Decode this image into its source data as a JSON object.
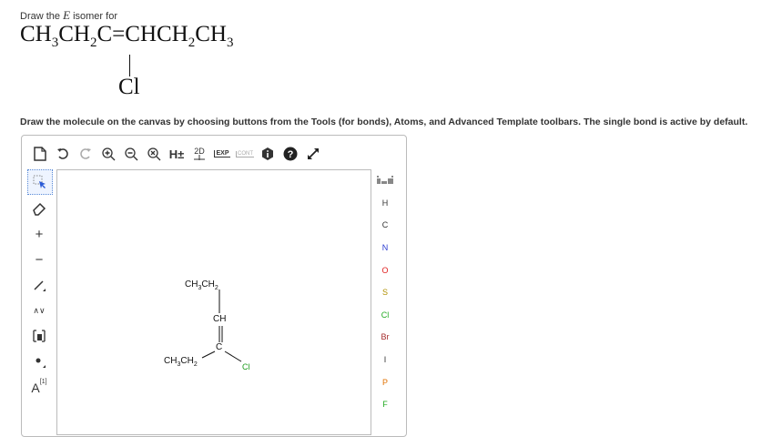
{
  "question": {
    "prompt_prefix": "Draw the ",
    "prompt_isomer": "E",
    "prompt_suffix": " isomer for",
    "formula": {
      "p1": "CH",
      "s1": "3",
      "p2": "CH",
      "s2": "2",
      "p3": "C",
      "p4": "=",
      "p5": "CHCH",
      "s5": "2",
      "p6": "CH",
      "s6": "3",
      "substituent": "Cl"
    },
    "instruction": "Draw the molecule on the canvas by choosing buttons from the Tools (for bonds), Atoms, and Advanced Template toolbars. The single bond is active by default."
  },
  "toolbar_top": {
    "hydrogen_label": "H±",
    "clean2d_label": "2D",
    "expand_label": "EXP",
    "contract_label": "CONT"
  },
  "toolbar_left": {
    "charge_plus": "+",
    "charge_minus": "−",
    "chain_label": "∧∨",
    "atom_map_label": "A",
    "atom_map_index": "[1]"
  },
  "atoms": [
    "H",
    "C",
    "N",
    "O",
    "S",
    "Cl",
    "Br",
    "I",
    "P",
    "F"
  ],
  "molecule": {
    "top_group": {
      "p1": "CH",
      "s1": "3",
      "p2": "CH",
      "s2": "2"
    },
    "ch": "CH",
    "c": "C",
    "bottom_group": {
      "p1": "CH",
      "s1": "3",
      "p2": "CH",
      "s2": "2"
    },
    "cl": "Cl"
  }
}
